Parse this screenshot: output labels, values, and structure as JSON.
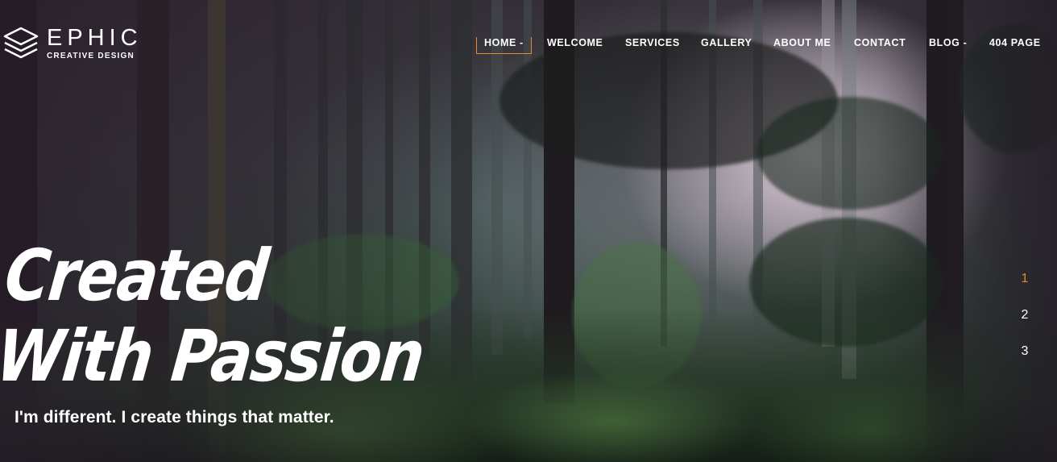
{
  "brand": {
    "name": "EPHIC",
    "tagline": "CREATIVE DESIGN",
    "icon": "layers-icon"
  },
  "nav": {
    "items": [
      {
        "label": "HOME -",
        "active": true
      },
      {
        "label": "WELCOME",
        "active": false
      },
      {
        "label": "SERVICES",
        "active": false
      },
      {
        "label": "GALLERY",
        "active": false
      },
      {
        "label": "ABOUT ME",
        "active": false
      },
      {
        "label": "CONTACT",
        "active": false
      },
      {
        "label": "BLOG -",
        "active": false
      },
      {
        "label": "404 PAGE",
        "active": false
      }
    ]
  },
  "hero": {
    "title_line1": "Created",
    "title_line2": "With Passion",
    "subtitle": "I'm different. I create things that matter."
  },
  "pager": {
    "items": [
      "1",
      "2",
      "3"
    ],
    "current": "1"
  },
  "colors": {
    "accent": "#e58a2e",
    "text": "#ffffff"
  }
}
